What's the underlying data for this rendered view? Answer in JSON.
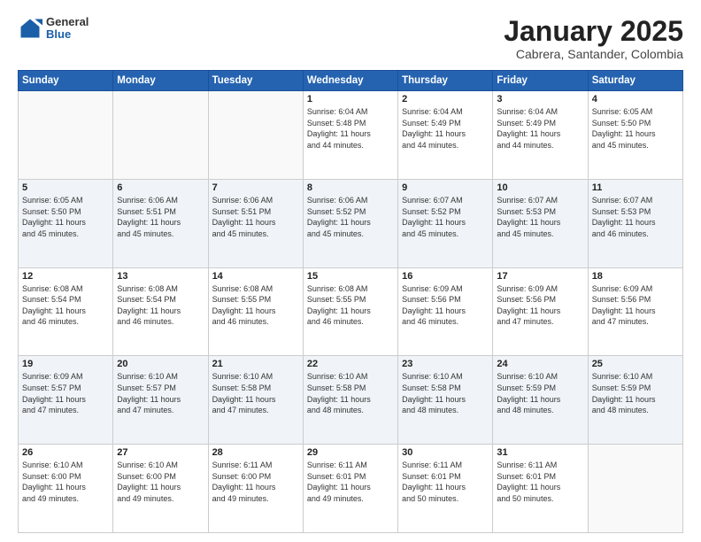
{
  "header": {
    "logo_general": "General",
    "logo_blue": "Blue",
    "title": "January 2025",
    "subtitle": "Cabrera, Santander, Colombia"
  },
  "days_of_week": [
    "Sunday",
    "Monday",
    "Tuesday",
    "Wednesday",
    "Thursday",
    "Friday",
    "Saturday"
  ],
  "weeks": [
    [
      {
        "day": "",
        "info": ""
      },
      {
        "day": "",
        "info": ""
      },
      {
        "day": "",
        "info": ""
      },
      {
        "day": "1",
        "info": "Sunrise: 6:04 AM\nSunset: 5:48 PM\nDaylight: 11 hours\nand 44 minutes."
      },
      {
        "day": "2",
        "info": "Sunrise: 6:04 AM\nSunset: 5:49 PM\nDaylight: 11 hours\nand 44 minutes."
      },
      {
        "day": "3",
        "info": "Sunrise: 6:04 AM\nSunset: 5:49 PM\nDaylight: 11 hours\nand 44 minutes."
      },
      {
        "day": "4",
        "info": "Sunrise: 6:05 AM\nSunset: 5:50 PM\nDaylight: 11 hours\nand 45 minutes."
      }
    ],
    [
      {
        "day": "5",
        "info": "Sunrise: 6:05 AM\nSunset: 5:50 PM\nDaylight: 11 hours\nand 45 minutes."
      },
      {
        "day": "6",
        "info": "Sunrise: 6:06 AM\nSunset: 5:51 PM\nDaylight: 11 hours\nand 45 minutes."
      },
      {
        "day": "7",
        "info": "Sunrise: 6:06 AM\nSunset: 5:51 PM\nDaylight: 11 hours\nand 45 minutes."
      },
      {
        "day": "8",
        "info": "Sunrise: 6:06 AM\nSunset: 5:52 PM\nDaylight: 11 hours\nand 45 minutes."
      },
      {
        "day": "9",
        "info": "Sunrise: 6:07 AM\nSunset: 5:52 PM\nDaylight: 11 hours\nand 45 minutes."
      },
      {
        "day": "10",
        "info": "Sunrise: 6:07 AM\nSunset: 5:53 PM\nDaylight: 11 hours\nand 45 minutes."
      },
      {
        "day": "11",
        "info": "Sunrise: 6:07 AM\nSunset: 5:53 PM\nDaylight: 11 hours\nand 46 minutes."
      }
    ],
    [
      {
        "day": "12",
        "info": "Sunrise: 6:08 AM\nSunset: 5:54 PM\nDaylight: 11 hours\nand 46 minutes."
      },
      {
        "day": "13",
        "info": "Sunrise: 6:08 AM\nSunset: 5:54 PM\nDaylight: 11 hours\nand 46 minutes."
      },
      {
        "day": "14",
        "info": "Sunrise: 6:08 AM\nSunset: 5:55 PM\nDaylight: 11 hours\nand 46 minutes."
      },
      {
        "day": "15",
        "info": "Sunrise: 6:08 AM\nSunset: 5:55 PM\nDaylight: 11 hours\nand 46 minutes."
      },
      {
        "day": "16",
        "info": "Sunrise: 6:09 AM\nSunset: 5:56 PM\nDaylight: 11 hours\nand 46 minutes."
      },
      {
        "day": "17",
        "info": "Sunrise: 6:09 AM\nSunset: 5:56 PM\nDaylight: 11 hours\nand 47 minutes."
      },
      {
        "day": "18",
        "info": "Sunrise: 6:09 AM\nSunset: 5:56 PM\nDaylight: 11 hours\nand 47 minutes."
      }
    ],
    [
      {
        "day": "19",
        "info": "Sunrise: 6:09 AM\nSunset: 5:57 PM\nDaylight: 11 hours\nand 47 minutes."
      },
      {
        "day": "20",
        "info": "Sunrise: 6:10 AM\nSunset: 5:57 PM\nDaylight: 11 hours\nand 47 minutes."
      },
      {
        "day": "21",
        "info": "Sunrise: 6:10 AM\nSunset: 5:58 PM\nDaylight: 11 hours\nand 47 minutes."
      },
      {
        "day": "22",
        "info": "Sunrise: 6:10 AM\nSunset: 5:58 PM\nDaylight: 11 hours\nand 48 minutes."
      },
      {
        "day": "23",
        "info": "Sunrise: 6:10 AM\nSunset: 5:58 PM\nDaylight: 11 hours\nand 48 minutes."
      },
      {
        "day": "24",
        "info": "Sunrise: 6:10 AM\nSunset: 5:59 PM\nDaylight: 11 hours\nand 48 minutes."
      },
      {
        "day": "25",
        "info": "Sunrise: 6:10 AM\nSunset: 5:59 PM\nDaylight: 11 hours\nand 48 minutes."
      }
    ],
    [
      {
        "day": "26",
        "info": "Sunrise: 6:10 AM\nSunset: 6:00 PM\nDaylight: 11 hours\nand 49 minutes."
      },
      {
        "day": "27",
        "info": "Sunrise: 6:10 AM\nSunset: 6:00 PM\nDaylight: 11 hours\nand 49 minutes."
      },
      {
        "day": "28",
        "info": "Sunrise: 6:11 AM\nSunset: 6:00 PM\nDaylight: 11 hours\nand 49 minutes."
      },
      {
        "day": "29",
        "info": "Sunrise: 6:11 AM\nSunset: 6:01 PM\nDaylight: 11 hours\nand 49 minutes."
      },
      {
        "day": "30",
        "info": "Sunrise: 6:11 AM\nSunset: 6:01 PM\nDaylight: 11 hours\nand 50 minutes."
      },
      {
        "day": "31",
        "info": "Sunrise: 6:11 AM\nSunset: 6:01 PM\nDaylight: 11 hours\nand 50 minutes."
      },
      {
        "day": "",
        "info": ""
      }
    ]
  ]
}
